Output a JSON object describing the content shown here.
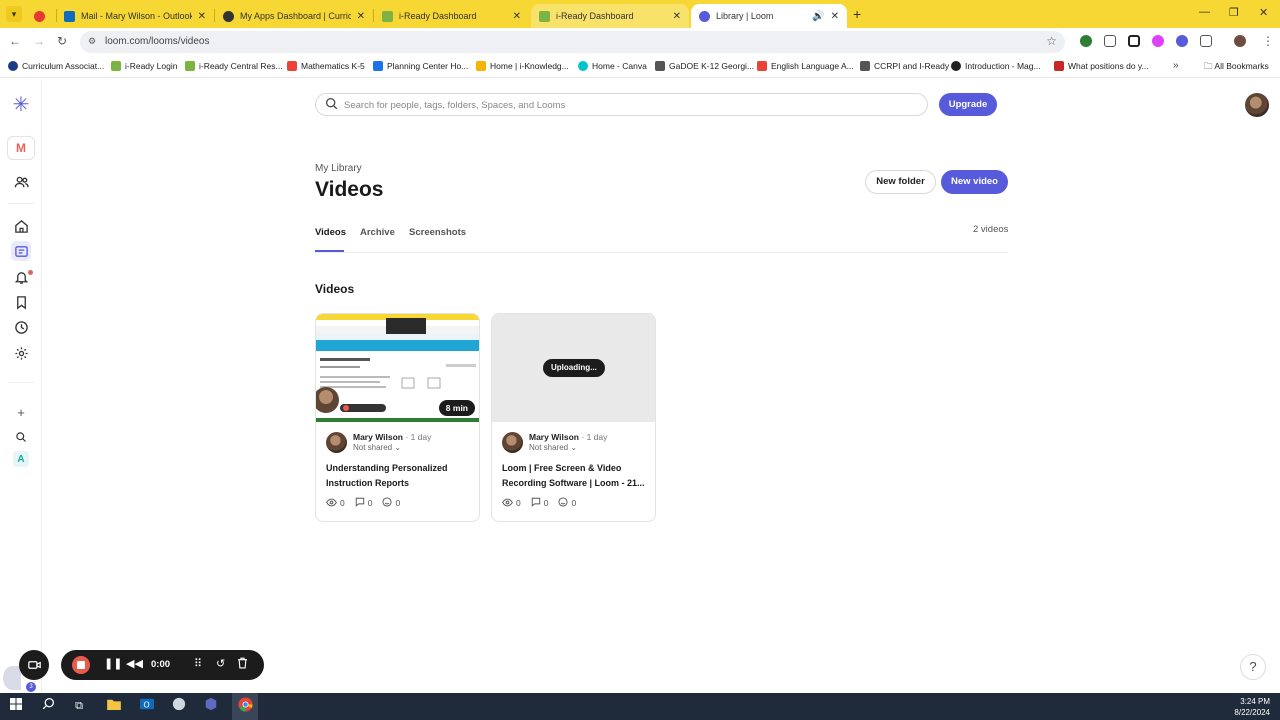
{
  "browser": {
    "tabs": [
      {
        "title": "",
        "favicon_color": "#e53935"
      },
      {
        "title": "Mail - Mary Wilson - Outlook",
        "favicon_color": "#0f6cbd"
      },
      {
        "title": "My Apps Dashboard | Curriculu",
        "favicon_color": "#333333"
      },
      {
        "title": "i-Ready Dashboard",
        "favicon_color": "#7cb342"
      },
      {
        "title": "i-Ready Dashboard",
        "favicon_color": "#7cb342"
      },
      {
        "title": "Library | Loom",
        "favicon_color": "#565adb"
      }
    ],
    "url": "loom.com/looms/videos",
    "bookmarks": [
      {
        "label": "Curriculum Associat...",
        "color": "#1e3a8a"
      },
      {
        "label": "i-Ready Login",
        "color": "#7cb342"
      },
      {
        "label": "i-Ready Central Res...",
        "color": "#7cb342"
      },
      {
        "label": "Mathematics K-5",
        "color": "#ea4335"
      },
      {
        "label": "Planning Center Ho...",
        "color": "#1a73e8"
      },
      {
        "label": "Home | i-Knowledg...",
        "color": "#f4b400"
      },
      {
        "label": "Home - Canva",
        "color": "#00c4cc"
      },
      {
        "label": "GaDOE K-12 Georgi...",
        "color": "#555555"
      },
      {
        "label": "English Language A...",
        "color": "#ea4335"
      },
      {
        "label": "CCRPI and I-Ready",
        "color": "#555555"
      },
      {
        "label": "Introduction - Mag...",
        "color": "#222222"
      },
      {
        "label": "What positions do y...",
        "color": "#c62828"
      }
    ],
    "all_bookmarks": "All Bookmarks"
  },
  "sidebar": {
    "workspace_initial": "M"
  },
  "header": {
    "search_placeholder": "Search for people, tags, folders, Spaces, and Looms",
    "upgrade_label": "Upgrade"
  },
  "library": {
    "breadcrumb": "My Library",
    "title": "Videos",
    "new_folder_label": "New folder",
    "new_video_label": "New video",
    "tabs": [
      "Videos",
      "Archive",
      "Screenshots"
    ],
    "video_count": "2 videos",
    "section_title": "Videos",
    "videos": [
      {
        "owner": "Mary Wilson",
        "age": "1 day",
        "sharing": "Not shared",
        "title": "Understanding Personalized Instruction Reports",
        "duration": "8 min",
        "views": "0",
        "comments": "0",
        "reactions": "0"
      },
      {
        "owner": "Mary Wilson",
        "age": "1 day",
        "sharing": "Not shared",
        "title": "Loom | Free Screen & Video Recording Software | Loom - 21...",
        "status": "Uploading...",
        "views": "0",
        "comments": "0",
        "reactions": "0"
      }
    ]
  },
  "recorder": {
    "time": "0:00",
    "bubble_badge": "3"
  },
  "help_label": "?",
  "taskbar": {
    "time": "3:24 PM",
    "date": "8/22/2024"
  },
  "colors": {
    "accent": "#565adb",
    "chrome_frame": "#f7d733",
    "record": "#e95b4b"
  }
}
